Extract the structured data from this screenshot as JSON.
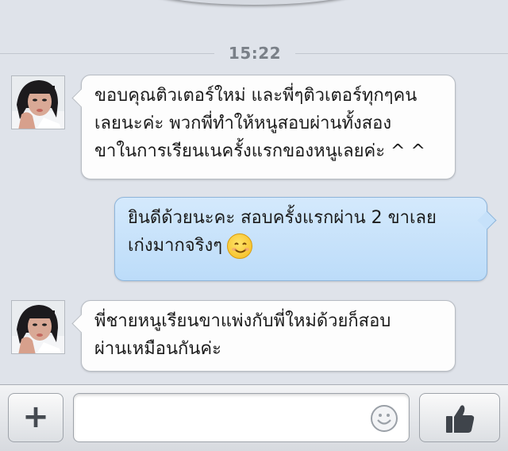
{
  "chat": {
    "timestamp": "15:22",
    "messages": [
      {
        "direction": "incoming",
        "lines": [
          "ขอบคุณติวเตอร์ใหม่ และพี่ๆติวเตอร์ทุกๆคน",
          "เลยนะค่ะ  พวกพี่ทำให้หนูสอบผ่านทั้งสอง",
          "ขาในการเรียนเนครั้งแรกของหนูเลยค่ะ ^ ^"
        ]
      },
      {
        "direction": "outgoing",
        "lines": [
          "ยินดีด้วยนะคะ สอบครั้งแรกผ่าน 2 ขาเลย",
          "เก่งมากจริงๆ"
        ],
        "emoji": "smiling-face-emoji"
      },
      {
        "direction": "incoming",
        "lines": [
          "พี่ชายหนูเรียนขาแพ่งกับพี่ใหม่ด้วยก็สอบ",
          "ผ่านเหมือนกันค่ะ"
        ]
      }
    ]
  },
  "composer": {
    "plus_label": "+",
    "input_value": "",
    "input_placeholder": "",
    "emoji_button_icon": "smiley-icon",
    "send_icon": "thumbs-up-icon"
  },
  "colors": {
    "background": "#dfe3ea",
    "incoming_bubble": "#fdfdfd",
    "outgoing_bubble": "#c6e1fa"
  }
}
